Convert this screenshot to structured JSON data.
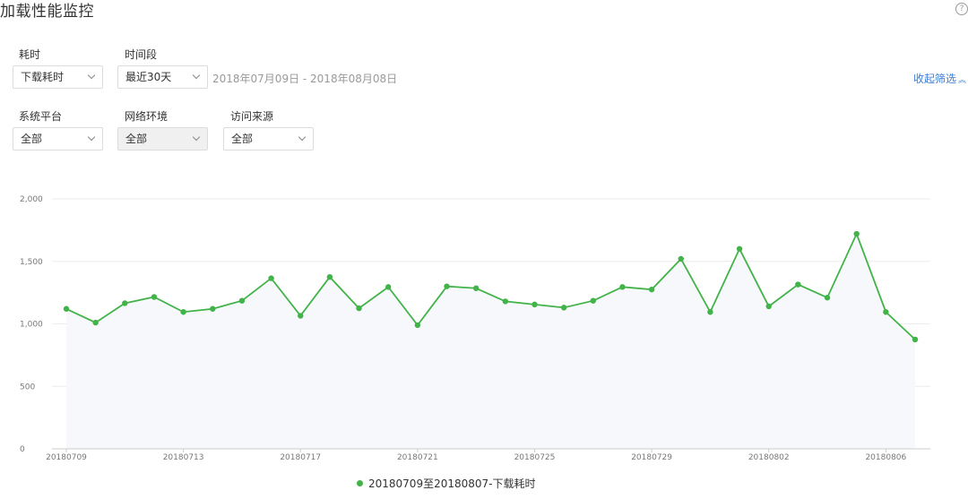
{
  "page": {
    "title": "加载性能监控",
    "help_icon": "question-icon"
  },
  "filters": {
    "duration_label": "耗时",
    "duration_value": "下载耗时",
    "period_label": "时间段",
    "period_value": "最近30天",
    "date_range": "2018年07月09日 - 2018年08月08日",
    "collapse_label": "收起筛选",
    "platform_label": "系统平台",
    "platform_value": "全部",
    "network_label": "网络环境",
    "network_value": "全部",
    "source_label": "访问来源",
    "source_value": "全部"
  },
  "colors": {
    "series": "#42b349",
    "area": "#f6f8fb",
    "grid": "#ececec",
    "tick": "#777777"
  },
  "chart_data": {
    "type": "line",
    "title": "",
    "xlabel": "",
    "ylabel": "",
    "ylim": [
      0,
      2000
    ],
    "yticks": [
      0,
      500,
      1000,
      1500,
      2000
    ],
    "ytick_labels": [
      "0",
      "500",
      "1,000",
      "1,500",
      "2,000"
    ],
    "x": [
      "20180709",
      "20180710",
      "20180711",
      "20180712",
      "20180713",
      "20180714",
      "20180715",
      "20180716",
      "20180717",
      "20180718",
      "20180719",
      "20180720",
      "20180721",
      "20180722",
      "20180723",
      "20180724",
      "20180725",
      "20180726",
      "20180727",
      "20180728",
      "20180729",
      "20180730",
      "20180731",
      "20180801",
      "20180802",
      "20180803",
      "20180804",
      "20180805",
      "20180806",
      "20180807"
    ],
    "xtick_labels": [
      "20180709",
      "20180713",
      "20180717",
      "20180721",
      "20180725",
      "20180729",
      "20180802",
      "20180806"
    ],
    "grid": true,
    "legend": "bottom-center",
    "series": [
      {
        "name": "20180709至20180807-下载耗时",
        "values": [
          1120,
          1010,
          1165,
          1215,
          1095,
          1120,
          1185,
          1365,
          1065,
          1375,
          1125,
          1295,
          990,
          1300,
          1285,
          1180,
          1155,
          1130,
          1185,
          1295,
          1275,
          1520,
          1095,
          1600,
          1140,
          1315,
          1210,
          1720,
          1095,
          875
        ]
      }
    ]
  }
}
